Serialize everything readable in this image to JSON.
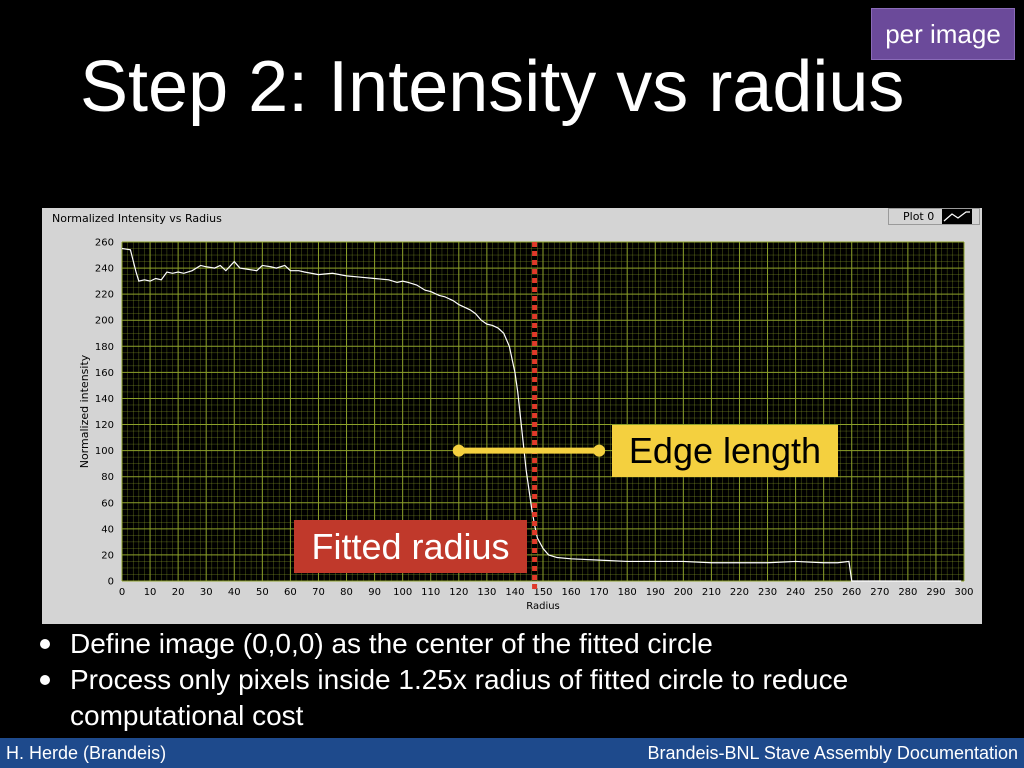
{
  "badge": "per image",
  "title": "Step 2: Intensity vs radius",
  "panel": {
    "title": "Normalized Intensity vs Radius",
    "legend_label": "Plot 0"
  },
  "annotations": {
    "edge_length": "Edge length",
    "fitted_radius": "Fitted radius"
  },
  "bullets": [
    "Define image (0,0,0) as the center of the fitted circle",
    "Process only pixels inside 1.25x radius of fitted circle to reduce computational cost"
  ],
  "footer": {
    "left": "H. Herde (Brandeis)",
    "right": "Brandeis-BNL Stave Assembly Documentation"
  },
  "colors": {
    "plot_bg": "#000000",
    "grid": "#8ca02a",
    "curve": "#ffffff",
    "fit_marker": "#e03a2a",
    "edge_marker": "#f4d03f",
    "edge_label_bg": "#f4d03f",
    "fit_label_bg": "#c0392b"
  },
  "chart_data": {
    "type": "line",
    "title": "Normalized Intensity vs Radius",
    "xlabel": "Radius",
    "ylabel": "Normalized intensity",
    "xlim": [
      0,
      300
    ],
    "ylim": [
      0,
      260
    ],
    "xticks": [
      0,
      10,
      20,
      30,
      40,
      50,
      60,
      70,
      80,
      90,
      100,
      110,
      120,
      130,
      140,
      150,
      160,
      170,
      180,
      190,
      200,
      210,
      220,
      230,
      240,
      250,
      260,
      270,
      280,
      290,
      300
    ],
    "yticks": [
      0,
      20,
      40,
      60,
      80,
      100,
      120,
      140,
      160,
      180,
      200,
      220,
      240,
      260
    ],
    "grid": true,
    "legend": "top-right",
    "series": [
      {
        "name": "Plot 0",
        "x": [
          0,
          3,
          5,
          6,
          8,
          10,
          12,
          14,
          16,
          18,
          20,
          22,
          25,
          28,
          30,
          33,
          35,
          37,
          40,
          42,
          45,
          48,
          50,
          53,
          55,
          58,
          60,
          63,
          65,
          70,
          75,
          80,
          85,
          90,
          95,
          98,
          100,
          102,
          105,
          108,
          110,
          113,
          115,
          118,
          120,
          122,
          124,
          126,
          128,
          130,
          132,
          134,
          136,
          138,
          139,
          140,
          141,
          142,
          143,
          144,
          145,
          146,
          147,
          148,
          150,
          152,
          155,
          160,
          170,
          180,
          190,
          200,
          210,
          220,
          230,
          240,
          250,
          255,
          259,
          260,
          270,
          280,
          290,
          299
        ],
        "values": [
          255,
          254,
          237,
          230,
          231,
          230,
          232,
          231,
          237,
          236,
          237,
          236,
          238,
          242,
          241,
          240,
          242,
          238,
          245,
          240,
          239,
          238,
          242,
          241,
          240,
          242,
          238,
          238,
          237,
          235,
          236,
          234,
          233,
          232,
          231,
          229,
          230,
          229,
          227,
          223,
          222,
          219,
          218,
          215,
          212,
          210,
          208,
          205,
          200,
          197,
          196,
          194,
          190,
          180,
          170,
          160,
          145,
          125,
          105,
          85,
          70,
          55,
          43,
          33,
          25,
          20,
          18,
          17,
          16,
          15,
          15,
          15,
          14,
          14,
          14,
          15,
          14,
          14,
          15,
          0,
          0,
          0,
          0,
          0
        ]
      }
    ],
    "markers": {
      "fitted_radius": 147,
      "edge_length_range": [
        120,
        170
      ],
      "edge_level": 100
    }
  }
}
